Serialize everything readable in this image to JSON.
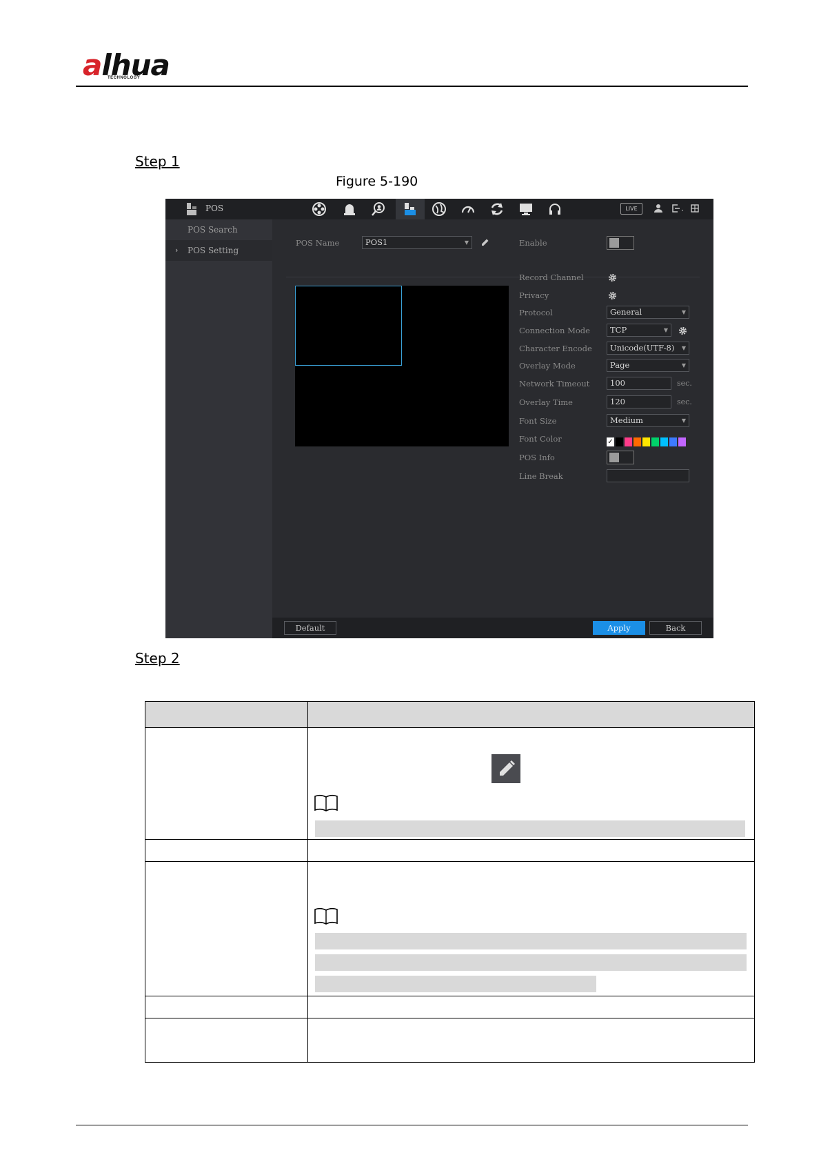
{
  "header": {
    "logo_main": "alhua",
    "logo_sub": "TECHNOLOGY"
  },
  "steps": {
    "step1": "Step 1",
    "step2": "Step 2"
  },
  "figure": {
    "caption": "Figure 5-190"
  },
  "ui": {
    "app_title": "POS",
    "toolbar_icons": [
      "camera-icon",
      "alarm-icon",
      "search-person-icon",
      "pos-icon",
      "network-icon",
      "gauge-icon",
      "refresh-icon",
      "monitor-icon",
      "headset-icon"
    ],
    "live_label": "LIVE",
    "sidebar": {
      "items": [
        {
          "label": "POS Search"
        },
        {
          "label": "POS Setting"
        }
      ],
      "arrow": "›"
    },
    "form": {
      "pos_name_label": "POS Name",
      "pos_name_value": "POS1",
      "enable_label": "Enable",
      "record_channel_label": "Record Channel",
      "privacy_label": "Privacy",
      "protocol_label": "Protocol",
      "protocol_value": "General",
      "connection_mode_label": "Connection Mode",
      "connection_mode_value": "TCP",
      "character_encode_label": "Character Encode",
      "character_encode_value": "Unicode(UTF-8)",
      "overlay_mode_label": "Overlay Mode",
      "overlay_mode_value": "Page",
      "network_timeout_label": "Network Timeout",
      "network_timeout_value": "100",
      "network_timeout_unit": "sec.",
      "overlay_time_label": "Overlay Time",
      "overlay_time_value": "120",
      "overlay_time_unit": "sec.",
      "font_size_label": "Font Size",
      "font_size_value": "Medium",
      "font_color_label": "Font Color",
      "font_colors": [
        "#ffffff",
        "#000000",
        "#ff3b8a",
        "#ff6a00",
        "#ffe600",
        "#00d26a",
        "#00c0ff",
        "#3d7bff",
        "#c266ff"
      ],
      "pos_info_label": "POS Info",
      "line_break_label": "Line Break",
      "line_break_value": ""
    },
    "buttons": {
      "default": "Default",
      "apply": "Apply",
      "back": "Back"
    },
    "accent": "#1b8fe6"
  }
}
